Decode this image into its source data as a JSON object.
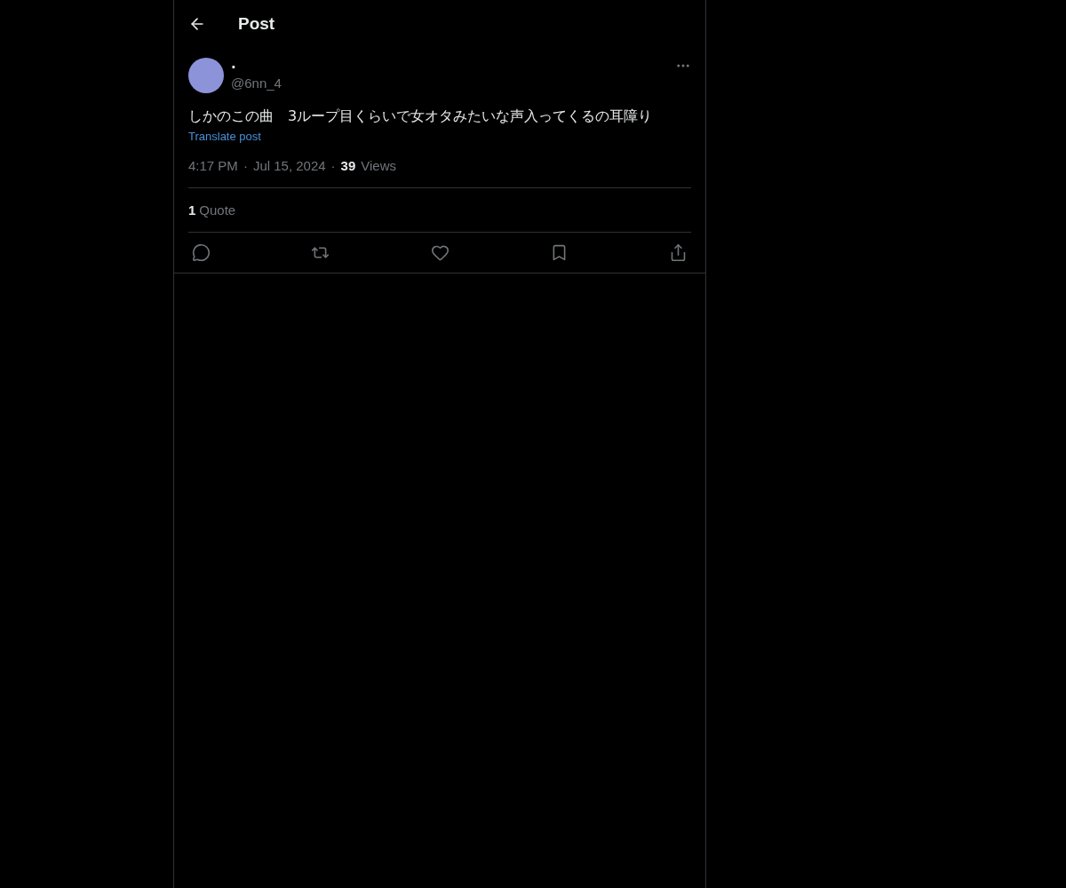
{
  "header": {
    "title": "Post"
  },
  "post": {
    "display_name": "·",
    "handle": "@6nn_4",
    "text": "しかのこの曲　3ループ目くらいで女オタみたいな声入ってくるの耳障り",
    "translate_link": "Translate post",
    "time": "4:17 PM",
    "separator": "·",
    "date": "Jul 15, 2024",
    "views_separator": "·",
    "views_count": "39",
    "views_label": "Views"
  },
  "stats": [
    {
      "count": "1",
      "label": "Quote"
    }
  ]
}
